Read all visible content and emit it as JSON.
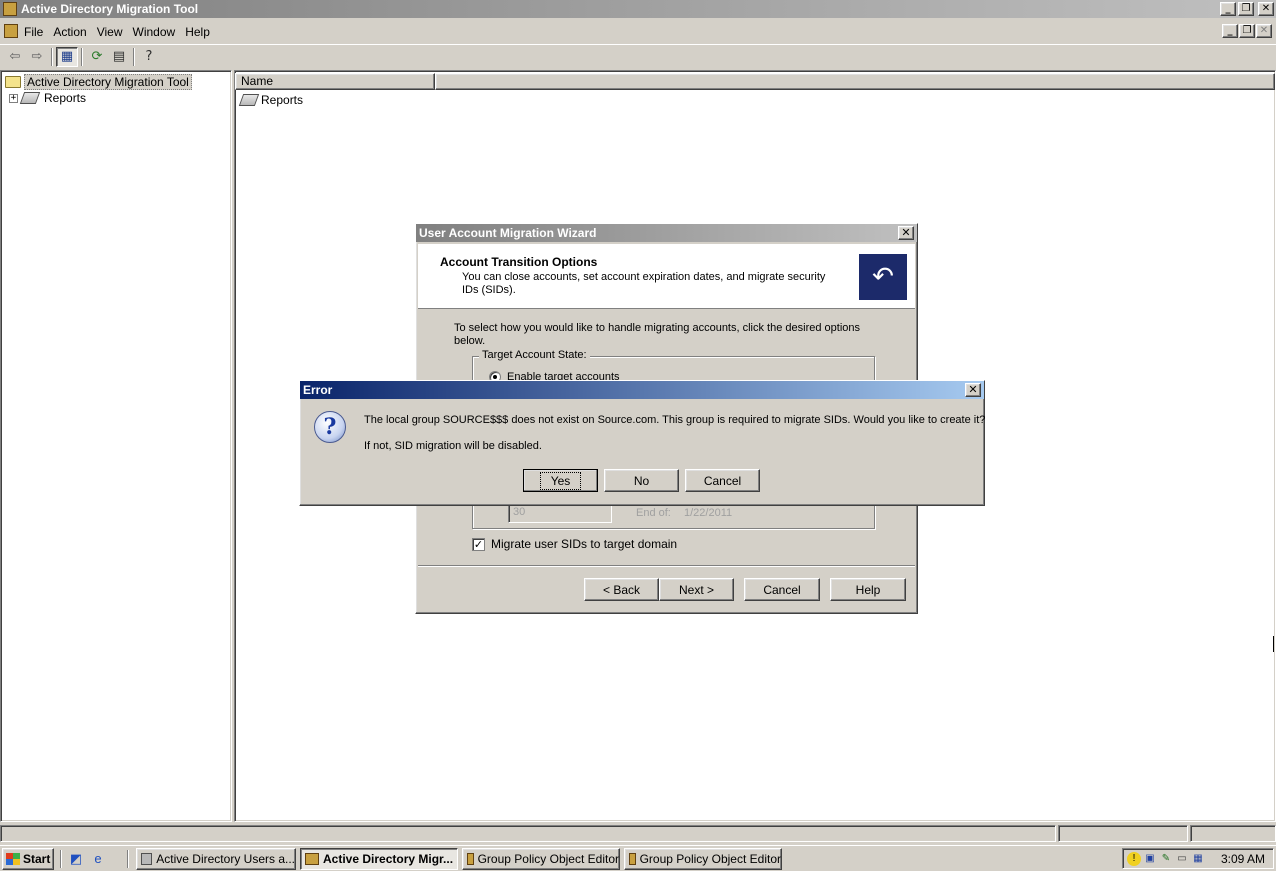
{
  "app": {
    "title": "Active Directory Migration Tool",
    "minimize_glyph": "_",
    "restore_glyph": "❐",
    "close_glyph": "✕"
  },
  "menubar": {
    "items": [
      {
        "label": "File",
        "key": "F"
      },
      {
        "label": "Action",
        "key": "A"
      },
      {
        "label": "View",
        "key": "V"
      },
      {
        "label": "Window",
        "key": "W"
      },
      {
        "label": "Help",
        "key": "H"
      }
    ]
  },
  "toolbar": {
    "icons": [
      "back-arrow-icon",
      "forward-arrow-icon",
      "show-hide-tree-icon",
      "refresh-icon",
      "export-list-icon",
      "help-icon"
    ]
  },
  "tree": {
    "root_label": "Active Directory Migration Tool",
    "child_label": "Reports",
    "expand_glyph": "+"
  },
  "list": {
    "column_header": "Name",
    "items": [
      "Reports"
    ]
  },
  "wizard": {
    "title": "User Account Migration Wizard",
    "header_title": "Account Transition Options",
    "header_subtitle": "You can close accounts, set account expiration dates, and migrate security IDs (SIDs).",
    "intro": "To select how you would like to handle migrating accounts, click the desired options below.",
    "group_label": "Target Account State:",
    "radio_enable": "Enable target accounts",
    "days_value": "30",
    "end_of_label": "End of:",
    "end_of_date": "1/22/2011",
    "migrate_sids_label": "Migrate user SIDs to target domain",
    "migrate_sids_checked": true,
    "buttons": {
      "back": "< Back",
      "next": "Next >",
      "cancel": "Cancel",
      "help": "Help"
    }
  },
  "error_dialog": {
    "title": "Error",
    "message": "The local group SOURCE$$$ does not exist on Source.com.  This group is required to migrate SIDs.  Would you like to create it?",
    "message2": "If not, SID migration will be disabled.",
    "icon": "question-icon",
    "buttons": {
      "yes": "Yes",
      "no": "No",
      "cancel": "Cancel"
    }
  },
  "taskbar": {
    "start_label": "Start",
    "tasks": [
      {
        "label": "Active Directory Users a...",
        "active": false
      },
      {
        "label": "Active Directory Migr...",
        "active": true
      },
      {
        "label": "Group Policy Object Editor",
        "active": false
      },
      {
        "label": "Group Policy Object Editor",
        "active": false
      }
    ],
    "clock": "3:09 AM"
  },
  "colors": {
    "active_title_start": "#0a246a",
    "active_title_end": "#a6caf0",
    "inactive_title_start": "#808080",
    "face": "#d4d0c8"
  }
}
